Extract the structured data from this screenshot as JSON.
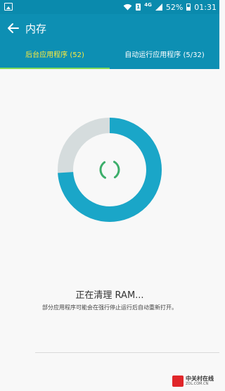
{
  "status_bar": {
    "network": "4G",
    "battery": "52%",
    "time": "01:31",
    "icons": [
      "gallery-icon",
      "wifi-icon",
      "sim-icon",
      "signal-icon",
      "battery-icon"
    ]
  },
  "app_bar": {
    "title": "内存",
    "back_icon": "back-arrow-icon"
  },
  "tabs": [
    {
      "label": "后台应用程序 (52)",
      "active": true
    },
    {
      "label": "自动运行应用程序 (5/32)",
      "active": false
    }
  ],
  "cleaning": {
    "ring_fill": 0.74,
    "title": "正在清理 RAM...",
    "description": "部分应用程序可能会在强行停止运行后自动重新打开。"
  },
  "colors": {
    "accent": "#0d8fb3",
    "status_bar": "#0a8aad",
    "ring_used": "#1aa6c8",
    "ring_free": "#d5dcdd",
    "spinner": "#3cae6a",
    "tab_active": "#ffeb3b",
    "tab_indicator": "#7ed957"
  },
  "watermark": {
    "cn": "中关村在线",
    "en": "ZOL.COM.CN",
    "logo_text": "ZOL"
  }
}
